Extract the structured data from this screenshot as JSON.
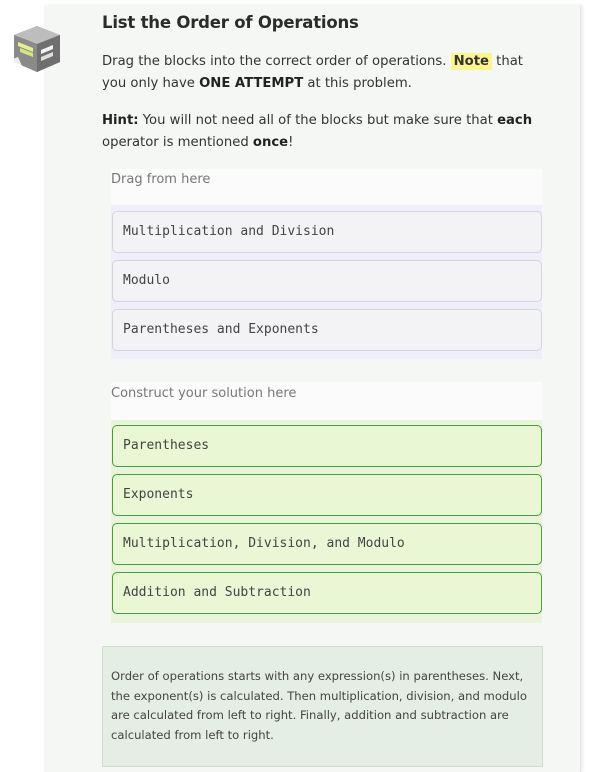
{
  "problem": {
    "title": "List the Order of Operations",
    "instructions": {
      "part1": "Drag the blocks into the correct order of operations.",
      "note": "Note",
      "part2": "that you only have",
      "attempt": "ONE ATTEMPT",
      "part3": "at this problem."
    },
    "hint": {
      "label": "Hint:",
      "part1": "You will not need all of the blocks but make sure that",
      "each": "each",
      "part2": "operator is mentioned",
      "once": "once",
      "part3": "!"
    }
  },
  "source_area": {
    "label": "Drag from here",
    "blocks": [
      "Multiplication and Division",
      "Modulo",
      "Parentheses and Exponents"
    ]
  },
  "solution_area": {
    "label": "Construct your solution here",
    "blocks": [
      "Parentheses",
      "Exponents",
      "Multiplication, Division, and Modulo",
      "Addition and Subtraction"
    ]
  },
  "feedback": {
    "text": "Order of operations starts with any expression(s) in parentheses. Next, the exponent(s) is calculated. Then multiplication, division, and modulo are calculated from left to right. Finally, addition and subtraction are calculated from left to right."
  },
  "colors": {
    "source_block_bg": "#f3f2f4",
    "solution_block_bg": "#e9f7d4",
    "solution_block_border": "#4a9d3c",
    "note_highlight": "#fbf58d"
  },
  "icons": {
    "logo": "parsons-blocks-logo-icon"
  }
}
